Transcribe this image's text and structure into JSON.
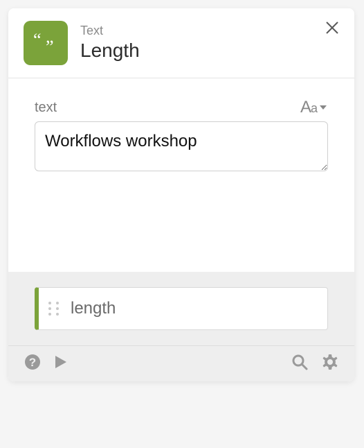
{
  "header": {
    "category": "Text",
    "title": "Length"
  },
  "input": {
    "label": "text",
    "type_hint": "Aa",
    "value": "Workflows workshop"
  },
  "output": {
    "label": "length"
  },
  "colors": {
    "accent": "#7ba33a"
  }
}
